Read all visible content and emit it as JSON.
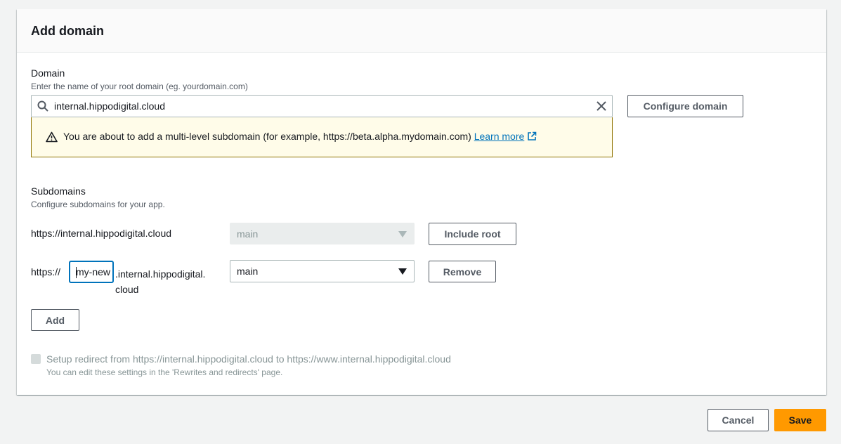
{
  "modal": {
    "title": "Add domain"
  },
  "domain": {
    "label": "Domain",
    "description": "Enter the name of your root domain (eg. yourdomain.com)",
    "value": "internal.hippodigital.cloud",
    "configure_button": "Configure domain"
  },
  "warning": {
    "message": "You are about to add a multi-level subdomain (for example, https://beta.alpha.mydomain.com) ",
    "link": "Learn more"
  },
  "subdomains": {
    "label": "Subdomains",
    "description": "Configure subdomains for your app.",
    "rows": [
      {
        "url": "https://internal.hippodigital.cloud",
        "branch": "main",
        "button": "Include root"
      },
      {
        "prefix": "https://",
        "input_value": "my-new",
        "suffix_line1": ".internal.hippodigital.",
        "suffix_line2": "cloud",
        "branch": "main",
        "button": "Remove"
      }
    ],
    "add_button": "Add"
  },
  "redirect": {
    "label": "Setup redirect from https://internal.hippodigital.cloud to https://www.internal.hippodigital.cloud",
    "hint": "You can edit these settings in the 'Rewrites and redirects' page."
  },
  "footer": {
    "cancel": "Cancel",
    "save": "Save"
  },
  "colors": {
    "accent": "#ec7211",
    "link": "#0073bb",
    "warning_border": "#8f7300",
    "warning_bg": "#fffce9"
  }
}
